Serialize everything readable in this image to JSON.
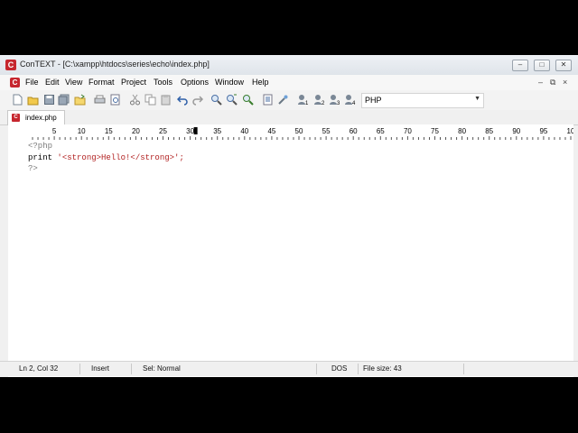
{
  "window": {
    "title": "ConTEXT - [C:\\xampp\\htdocs\\series\\echo\\index.php]",
    "icon": "context-app-icon",
    "controls": [
      "minimize",
      "maximize",
      "close"
    ]
  },
  "menu": {
    "items": [
      "File",
      "Edit",
      "View",
      "Format",
      "Project",
      "Tools",
      "Options",
      "Window",
      "Help"
    ]
  },
  "toolbar": {
    "buttons": [
      "new-file-icon",
      "open-file-icon",
      "save-icon",
      "save-all-icon",
      "open-folder-icon",
      "print-icon",
      "print-preview-icon",
      "cut-icon",
      "copy-icon",
      "paste-icon",
      "undo-icon",
      "redo-icon",
      "find-icon",
      "find-next-icon",
      "replace-icon",
      "export-icon",
      "tools-icon",
      "user-command-1-icon",
      "user-command-2-icon",
      "user-command-3-icon",
      "user-command-4-icon"
    ],
    "highlighter": "PHP"
  },
  "tabs": [
    {
      "label": "index.php",
      "active": true
    }
  ],
  "ruler": {
    "labels": [
      "5",
      "10",
      "15",
      "20",
      "25",
      "30",
      "35",
      "40",
      "45",
      "50",
      "55",
      "60",
      "65",
      "70",
      "75",
      "80",
      "85",
      "90",
      "95",
      "10"
    ]
  },
  "editor": {
    "lines": [
      [
        {
          "text": "<?php",
          "color": "#7a7a7a"
        }
      ],
      [
        {
          "text": "print",
          "color": "#000000"
        },
        {
          "text": " '<strong>Hello!</strong>';",
          "color": "#b22222"
        }
      ],
      [
        {
          "text": "?>",
          "color": "#7a7a7a"
        }
      ]
    ]
  },
  "status": {
    "position": "Ln 2, Col 32",
    "mode": "Insert",
    "selection": "Sel: Normal",
    "line_endings": "DOS",
    "file_size": "File size: 43"
  }
}
